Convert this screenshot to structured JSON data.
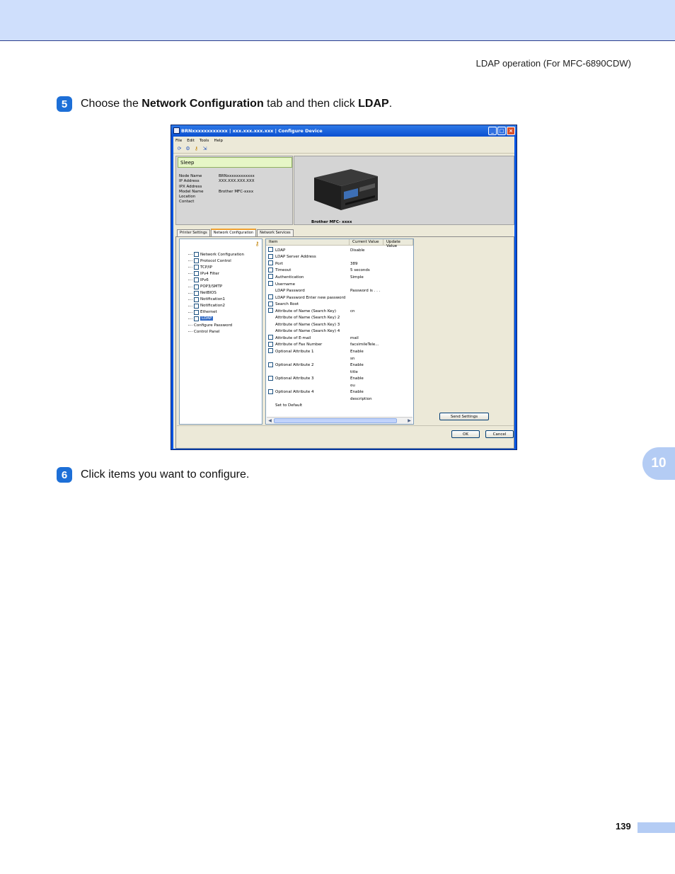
{
  "header": {
    "running_head": "LDAP operation (For MFC-6890CDW)"
  },
  "steps": [
    {
      "number": "5",
      "text_before": "Choose the ",
      "bold1": "Network Configuration",
      "text_middle": " tab and then click ",
      "bold2": "LDAP",
      "text_after": "."
    },
    {
      "number": "6",
      "text": "Click items you want to configure."
    }
  ],
  "chapter_tab": "10",
  "page_number": "139",
  "colors": {
    "band": "#cfdffc",
    "accent": "#1d6fd7",
    "chapter_tab": "#b4ccf4"
  },
  "window": {
    "title": "BRNxxxxxxxxxxxx   | xxx.xxx.xxx.xxx | Configure Device",
    "menu": [
      "File",
      "Edit",
      "Tools",
      "Help"
    ],
    "toolbar_icons": [
      "refresh-icon",
      "settings-icon",
      "key-icon",
      "export-icon"
    ],
    "status": "Sleep",
    "info": [
      {
        "k": "Node Name",
        "v": "BRNxxxxxxxxxxxx"
      },
      {
        "k": "IP Address",
        "v": "XXX.XXX.XXX.XXX"
      },
      {
        "k": "IPX Address",
        "v": ""
      },
      {
        "k": "Model Name",
        "v": "Brother MFC-xxxx"
      },
      {
        "k": "Location",
        "v": ""
      },
      {
        "k": "Contact",
        "v": ""
      }
    ],
    "printer_caption": "Brother MFC- xxxx",
    "tabs": [
      "Printer Settings",
      "Network Configuration",
      "Network Services"
    ],
    "tree": [
      "Network Configuration",
      "Protocol Control",
      "TCP/IP",
      "IPv4 Filter",
      "IPv6",
      "POP3/SMTP",
      "NetBIOS",
      "Notification1",
      "Notification2",
      "Ethernet",
      "LDAP",
      "Configure Password",
      "Control Panel"
    ],
    "list_headers": [
      "Item",
      "Current Value",
      "Update Value"
    ],
    "list_rows": [
      {
        "cb": true,
        "item": "LDAP",
        "value": "Disable"
      },
      {
        "cb": true,
        "item": "LDAP Server Address",
        "value": ""
      },
      {
        "cb": true,
        "item": "Port",
        "value": "389"
      },
      {
        "cb": true,
        "item": "Timeout",
        "value": "5 seconds"
      },
      {
        "cb": true,
        "item": "Authentication",
        "value": "Simple"
      },
      {
        "cb": true,
        "item": "Username",
        "value": ""
      },
      {
        "cb": false,
        "item": "LDAP Password",
        "value": "Password is . . ."
      },
      {
        "cb": true,
        "item": "LDAP Password Enter new password",
        "value": ""
      },
      {
        "cb": true,
        "item": "Search Root",
        "value": ""
      },
      {
        "cb": true,
        "item": "Attribute of Name (Search Key)",
        "value": "cn"
      },
      {
        "cb": false,
        "item": "Attribute of Name (Search Key) 2",
        "value": ""
      },
      {
        "cb": false,
        "item": "Attribute of Name (Search Key) 3",
        "value": ""
      },
      {
        "cb": false,
        "item": "Attribute of Name (Search Key) 4",
        "value": ""
      },
      {
        "cb": true,
        "item": "Attribute of E-mail",
        "value": "mail"
      },
      {
        "cb": true,
        "item": "Attribute of Fax Number",
        "value": "facsimileTele..."
      },
      {
        "cb": true,
        "item": "Optional Attribute 1",
        "value": "Enable"
      },
      {
        "cb": false,
        "item": "",
        "value": "sn"
      },
      {
        "cb": true,
        "item": "Optional Attribute 2",
        "value": "Enable"
      },
      {
        "cb": false,
        "item": "",
        "value": "title"
      },
      {
        "cb": true,
        "item": "Optional Attribute 3",
        "value": "Enable"
      },
      {
        "cb": false,
        "item": "",
        "value": "ou"
      },
      {
        "cb": true,
        "item": "Optional Attribute 4",
        "value": "Enable"
      },
      {
        "cb": false,
        "item": "",
        "value": "description"
      },
      {
        "cb": false,
        "item": "Set to Default",
        "value": ""
      }
    ],
    "buttons": {
      "send": "Send Settings",
      "ok": "OK",
      "cancel": "Cancel"
    }
  }
}
